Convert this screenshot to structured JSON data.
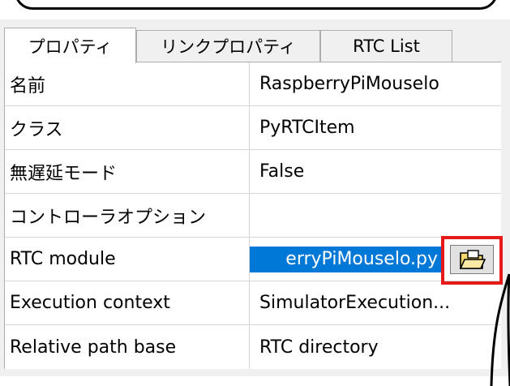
{
  "tabs": [
    {
      "label": "プロパティ",
      "active": true
    },
    {
      "label": "リンクプロパティ",
      "active": false
    },
    {
      "label": "RTC List",
      "active": false
    }
  ],
  "properties": [
    {
      "name": "名前",
      "value": "RaspberryPiMouselo"
    },
    {
      "name": "クラス",
      "value": "PyRTCItem"
    },
    {
      "name": "無遅延モード",
      "value": "False"
    },
    {
      "name": "コントローラオプション",
      "value": ""
    },
    {
      "name": "RTC module",
      "value": "erryPiMouselo.py"
    },
    {
      "name": "Execution context",
      "value": "SimulatorExecution..."
    },
    {
      "name": "Relative path base",
      "value": "RTC directory"
    }
  ],
  "colors": {
    "selection": "#0078d7",
    "highlight": "#e81919",
    "panel_bg": "#f0f0f0"
  },
  "icons": {
    "browse": "folder-open-icon"
  }
}
